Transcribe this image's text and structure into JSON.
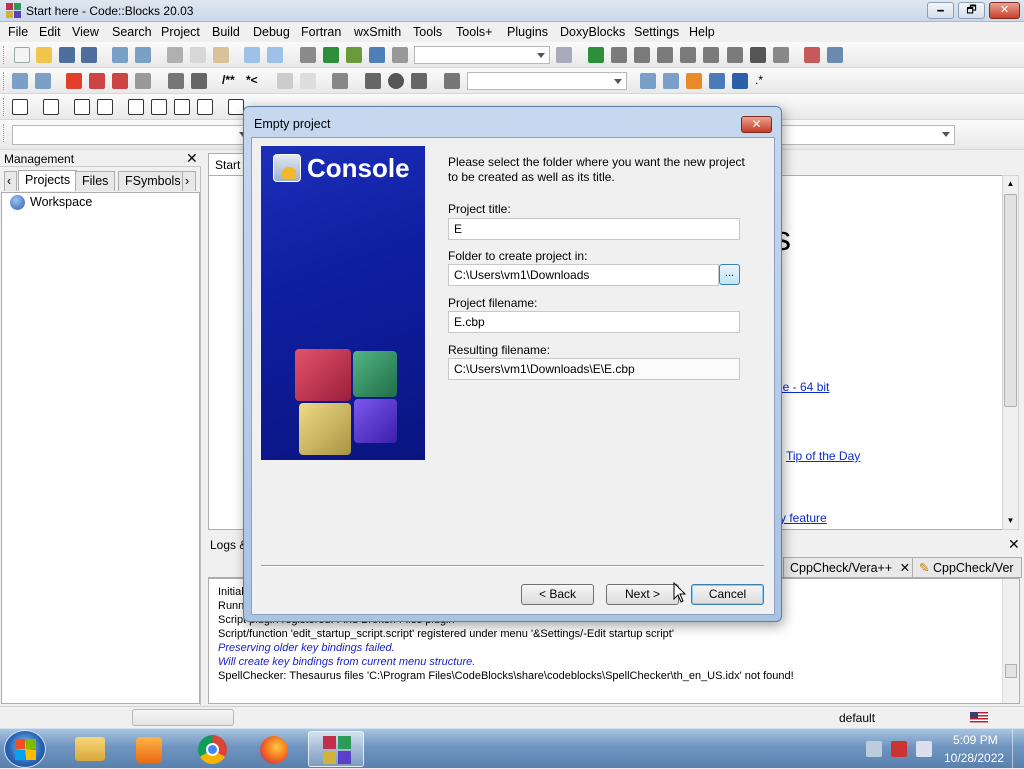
{
  "window": {
    "title": "Start here - Code::Blocks 20.03",
    "min": "🗕",
    "max": "🗗",
    "close": "✕"
  },
  "menubar": [
    "File",
    "Edit",
    "View",
    "Search",
    "Project",
    "Build",
    "Debug",
    "Fortran",
    "wxSmith",
    "Tools",
    "Tools+",
    "Plugins",
    "DoxyBlocks",
    "Settings",
    "Help"
  ],
  "toolbar2": {
    "doc_comment": "/**",
    "line_comment": "*<",
    "regex": ".*"
  },
  "management": {
    "title": "Management",
    "tabs": [
      "Projects",
      "Files",
      "FSymbols"
    ],
    "tree_root": "Workspace"
  },
  "editor": {
    "tab": "Start",
    "partial_heading": "s",
    "links": [
      "de - 64 bit",
      "Tip of the Day",
      "y feature"
    ]
  },
  "logs": {
    "title": "Logs &",
    "tabs": [
      "CppCheck/Vera++",
      "CppCheck/Ver"
    ],
    "lines": [
      {
        "text": "Initial",
        "style": "normal"
      },
      {
        "text": "Runni",
        "style": "normal"
      },
      {
        "text": "Script plugin registered: Find Broken Files plugin",
        "style": "normal"
      },
      {
        "text": "Script/function 'edit_startup_script.script' registered under menu '&Settings/-Edit startup script'",
        "style": "normal"
      },
      {
        "text": "Preserving older key bindings failed.",
        "style": "blue"
      },
      {
        "text": "Will create key bindings from current menu structure.",
        "style": "blue"
      },
      {
        "text": "SpellChecker: Thesaurus files 'C:\\Program Files\\CodeBlocks\\share\\codeblocks\\SpellChecker\\th_en_US.idx' not found!",
        "style": "normal"
      }
    ]
  },
  "statusbar": {
    "mode": "default"
  },
  "taskbar": {
    "time": "5:09 PM",
    "date": "10/28/2022"
  },
  "dialog": {
    "title": "Empty project",
    "close": "✕",
    "banner_title": "Console",
    "intro": "Please select the folder where you want the new project to be created as well as its title.",
    "project_title_label": "Project title:",
    "project_title_value": "E",
    "folder_label": "Folder to create project in:",
    "folder_value": "C:\\Users\\vm1\\Downloads",
    "browse_label": "...",
    "filename_label": "Project filename:",
    "filename_value": "E.cbp",
    "resulting_label": "Resulting filename:",
    "resulting_value": "C:\\Users\\vm1\\Downloads\\E\\E.cbp",
    "back_label": "< Back",
    "next_label": "Next >",
    "cancel_label": "Cancel"
  }
}
